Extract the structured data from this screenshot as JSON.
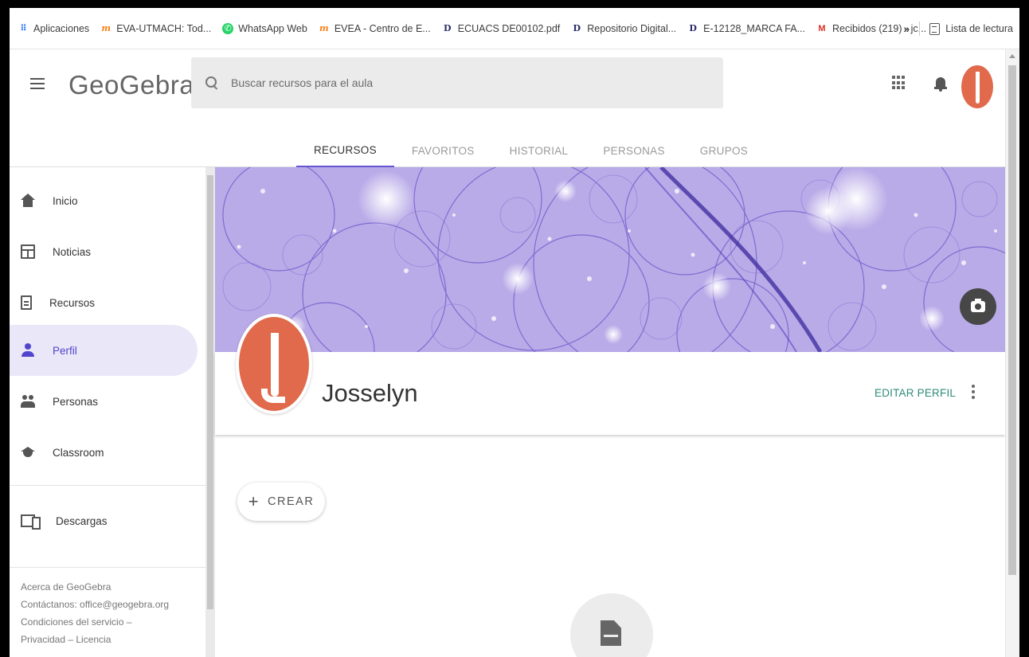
{
  "bookmarks": {
    "items": [
      {
        "label": "Aplicaciones",
        "icon": "apps-grid-icon"
      },
      {
        "label": "EVA-UTMACH: Tod...",
        "icon": "moodle-icon"
      },
      {
        "label": "WhatsApp Web",
        "icon": "whatsapp-icon"
      },
      {
        "label": "EVEA - Centro de E...",
        "icon": "moodle-icon"
      },
      {
        "label": "ECUACS DE00102.pdf",
        "icon": "dspace-icon"
      },
      {
        "label": "Repositorio Digital...",
        "icon": "dspace-icon"
      },
      {
        "label": "E-12128_MARCA FA...",
        "icon": "dspace-icon"
      },
      {
        "label": "Recibidos (219) - jc...",
        "icon": "gmail-icon"
      }
    ],
    "more": "»",
    "reading_list": "Lista de lectura"
  },
  "header": {
    "logo": "GeoGebra",
    "search_placeholder": "Buscar recursos para el aula",
    "search_value": ""
  },
  "tabs": [
    {
      "label": "RECURSOS",
      "active": true
    },
    {
      "label": "FAVORITOS",
      "active": false
    },
    {
      "label": "HISTORIAL",
      "active": false
    },
    {
      "label": "PERSONAS",
      "active": false
    },
    {
      "label": "GRUPOS",
      "active": false
    }
  ],
  "sidebar": {
    "items": [
      {
        "label": "Inicio",
        "icon": "home-icon"
      },
      {
        "label": "Noticias",
        "icon": "news-icon"
      },
      {
        "label": "Recursos",
        "icon": "document-icon"
      },
      {
        "label": "Perfil",
        "icon": "person-icon",
        "active": true
      },
      {
        "label": "Personas",
        "icon": "people-icon"
      },
      {
        "label": "Classroom",
        "icon": "school-icon"
      },
      {
        "label": "Descargas",
        "icon": "devices-icon"
      }
    ],
    "footer": {
      "about": "Acerca de GeoGebra",
      "contact": "Contáctanos: office@geogebra.org",
      "terms": "Condiciones del servicio –",
      "privacy": "Privacidad – Licencia"
    }
  },
  "profile": {
    "name": "Josselyn",
    "edit_label": "EDITAR PERFIL",
    "avatar_color": "#e06a4b"
  },
  "actions": {
    "create_label": "CREAR",
    "create_symbol": "+"
  },
  "colors": {
    "accent": "#5145cd",
    "edit_link": "#2e8b79",
    "active_nav_bg": "#eae7f8"
  }
}
